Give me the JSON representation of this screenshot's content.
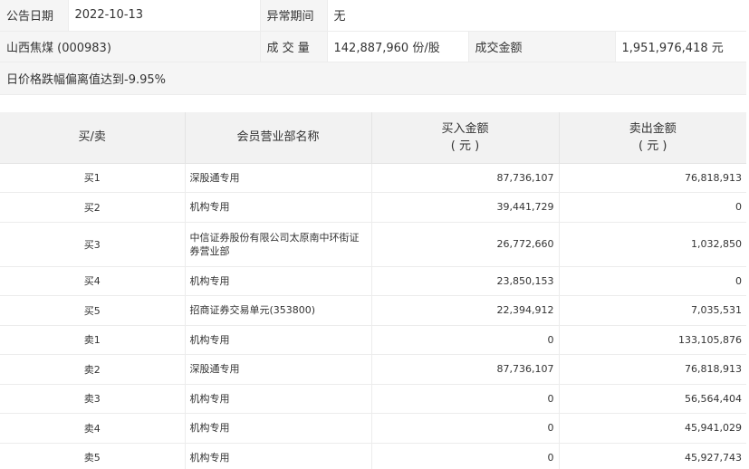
{
  "info": {
    "announce_date_label": "公告日期",
    "announce_date": "2022-10-13",
    "abnormal_period_label": "异常期间",
    "abnormal_period": "无",
    "stock_name": "山西焦煤 (000983)",
    "volume_label": "成 交 量",
    "volume": "142,887,960 份/股",
    "turnover_label": "成交金额",
    "turnover": "1,951,976,418 元",
    "reason": "日价格跌幅偏离值达到-9.95%"
  },
  "table": {
    "headers": {
      "side": "买/卖",
      "branch": "会员营业部名称",
      "buy_line1": "买入金额",
      "buy_line2": "( 元 )",
      "sell_line1": "卖出金额",
      "sell_line2": "( 元 )"
    },
    "rows": [
      {
        "side": "买1",
        "branch": "深股通专用",
        "buy": "87,736,107",
        "sell": "76,818,913"
      },
      {
        "side": "买2",
        "branch": "机构专用",
        "buy": "39,441,729",
        "sell": "0"
      },
      {
        "side": "买3",
        "branch": "中信证券股份有限公司太原南中环街证券营业部",
        "buy": "26,772,660",
        "sell": "1,032,850"
      },
      {
        "side": "买4",
        "branch": "机构专用",
        "buy": "23,850,153",
        "sell": "0"
      },
      {
        "side": "买5",
        "branch": "招商证券交易单元(353800)",
        "buy": "22,394,912",
        "sell": "7,035,531"
      },
      {
        "side": "卖1",
        "branch": "机构专用",
        "buy": "0",
        "sell": "133,105,876"
      },
      {
        "side": "卖2",
        "branch": "深股通专用",
        "buy": "87,736,107",
        "sell": "76,818,913"
      },
      {
        "side": "卖3",
        "branch": "机构专用",
        "buy": "0",
        "sell": "56,564,404"
      },
      {
        "side": "卖4",
        "branch": "机构专用",
        "buy": "0",
        "sell": "45,941,029"
      },
      {
        "side": "卖5",
        "branch": "机构专用",
        "buy": "0",
        "sell": "45,927,743"
      }
    ]
  }
}
